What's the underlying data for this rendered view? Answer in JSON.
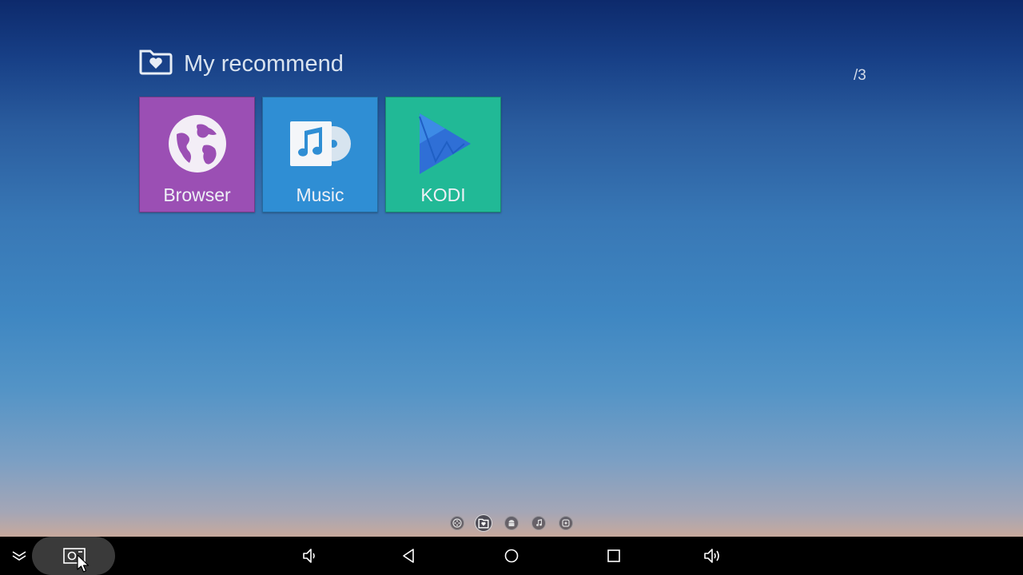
{
  "section": {
    "title": "My recommend",
    "icon": "folder-heart-icon"
  },
  "pager": {
    "indicator": "/3"
  },
  "tiles": [
    {
      "label": "Browser",
      "icon": "globe-icon",
      "color": "#9b4fb4"
    },
    {
      "label": "Music",
      "icon": "music-disc-icon",
      "color": "#2f8ed4"
    },
    {
      "label": "KODI",
      "icon": "kodi-play-icon",
      "color": "#21b996"
    }
  ],
  "page_dots": [
    {
      "icon": "film-reel-icon",
      "active": false
    },
    {
      "icon": "folder-heart-icon",
      "active": true
    },
    {
      "icon": "android-icon",
      "active": false
    },
    {
      "icon": "music-note-icon",
      "active": false
    },
    {
      "icon": "settings-icon",
      "active": false
    }
  ],
  "navbar": {
    "buttons": [
      "collapse-icon",
      "screenshot-icon",
      "volume-down-icon",
      "back-icon",
      "home-icon",
      "recents-icon",
      "volume-up-icon"
    ]
  }
}
